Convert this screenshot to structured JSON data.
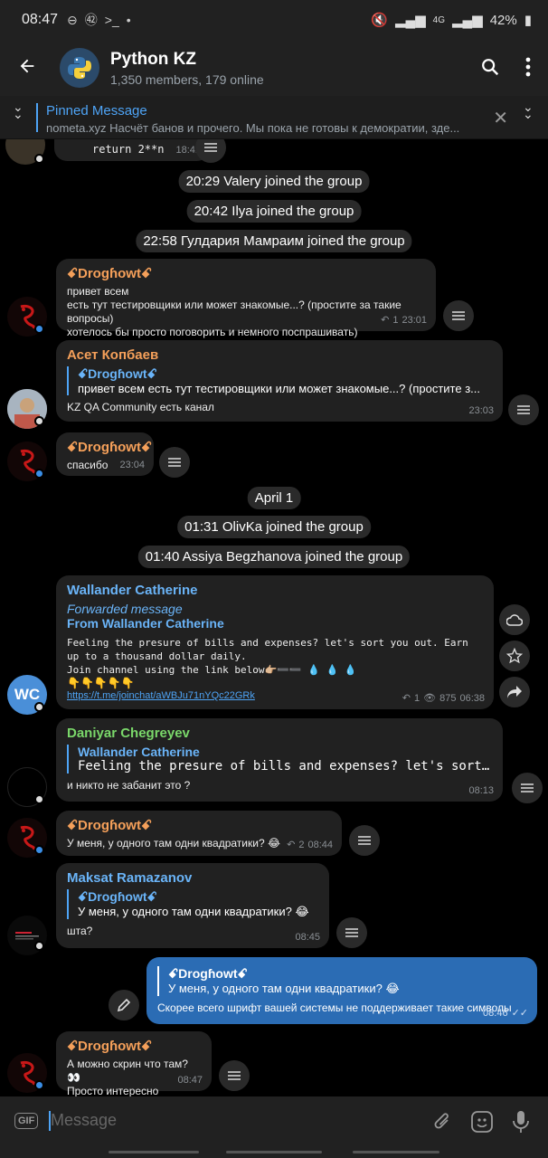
{
  "statusbar": {
    "time": "08:47",
    "battery": "42%",
    "network": "4G"
  },
  "header": {
    "title": "Python KZ",
    "subtitle": "1,350 members, 179 online"
  },
  "pinned": {
    "title": "Pinned Message",
    "text": "nometa.xyz  Насчёт банов и прочего. Мы пока не готовы к демократии, зде..."
  },
  "messages": {
    "top_code": {
      "text": "return 2**n",
      "time": "18:41"
    },
    "svc1": "20:29 Valery joined the group",
    "svc2": "20:42 Ilya joined the group",
    "svc3": "22:58 Гулдария Мамраим joined the group",
    "m1": {
      "sender": "ꗃDrogɦowtꗃ",
      "line1": "привет всем",
      "line2": "есть тут тестировщики или может знакомые...? (простите за такие вопросы)",
      "line3": "хотелось бы просто поговорить и немного поспрашивать)",
      "replies": "1",
      "time": "23:01"
    },
    "m2": {
      "sender": "Асет Копбаев",
      "reply_name": "ꗃDrogɦowtꗃ",
      "reply_text": "привет всем есть тут тестировщики или может знакомые...? (простите з...",
      "text": "KZ QA Community есть канал",
      "time": "23:03"
    },
    "m3": {
      "sender": "ꗃDrogɦowtꗃ",
      "text": "спасибо",
      "time": "23:04"
    },
    "date": "April 1",
    "svc4": "01:31 OlivKa joined the group",
    "svc5": "01:40 Assiya Begzhanova joined the group",
    "m4": {
      "sender": "Wallander Catherine",
      "fwd": "Forwarded message",
      "from": "From Wallander Catherine",
      "line1": "Feeling the presure of bills and expenses? let's sort you out. Earn",
      "line2": "up to a thousand dollar daily.",
      "line3": "Join channel using the link below👉🏼➖➖ 💧 💧 💧",
      "line4": "👇👇👇👇👇",
      "link": "https://t.me/joinchat/aWBJu71nYQc22GRk",
      "replies": "1",
      "views": "875",
      "time": "06:38",
      "avatar_text": "WC"
    },
    "m5": {
      "sender": "Daniyar Chegreyev",
      "reply_name": "Wallander Catherine",
      "reply_text": "Feeling the presure of bills and expenses? let's sort y...",
      "text": "и никто не забанит это ?",
      "time": "08:13"
    },
    "m6": {
      "sender": "ꗃDrogɦowtꗃ",
      "text": "У меня,  у одного там одни квадратики? 😂",
      "replies": "2",
      "time": "08:44"
    },
    "m7": {
      "sender": "Maksat Ramazanov",
      "reply_name": "ꗃDrogɦowtꗃ",
      "reply_text": "У меня,  у одного там одни квадратики? 😂",
      "text": "шта?",
      "time": "08:45"
    },
    "m8": {
      "reply_name": "ꗃDrogɦowtꗃ",
      "reply_text": "У меня,  у одного там одни квадратики? 😂",
      "text": "Скорее всего шрифт вашей системы не поддерживает такие символы",
      "time": "08:46"
    },
    "m9": {
      "sender": "ꗃDrogɦowtꗃ",
      "line1": "А можно скрин что там? 👀",
      "line2": "Просто интересно",
      "time": "08:47"
    }
  },
  "input": {
    "placeholder": "Message",
    "gif": "GIF"
  },
  "colors": {
    "accent": "#4ea4f6",
    "out_bubble": "#2b6cb4",
    "bubble": "#212121",
    "header": "#212121"
  }
}
